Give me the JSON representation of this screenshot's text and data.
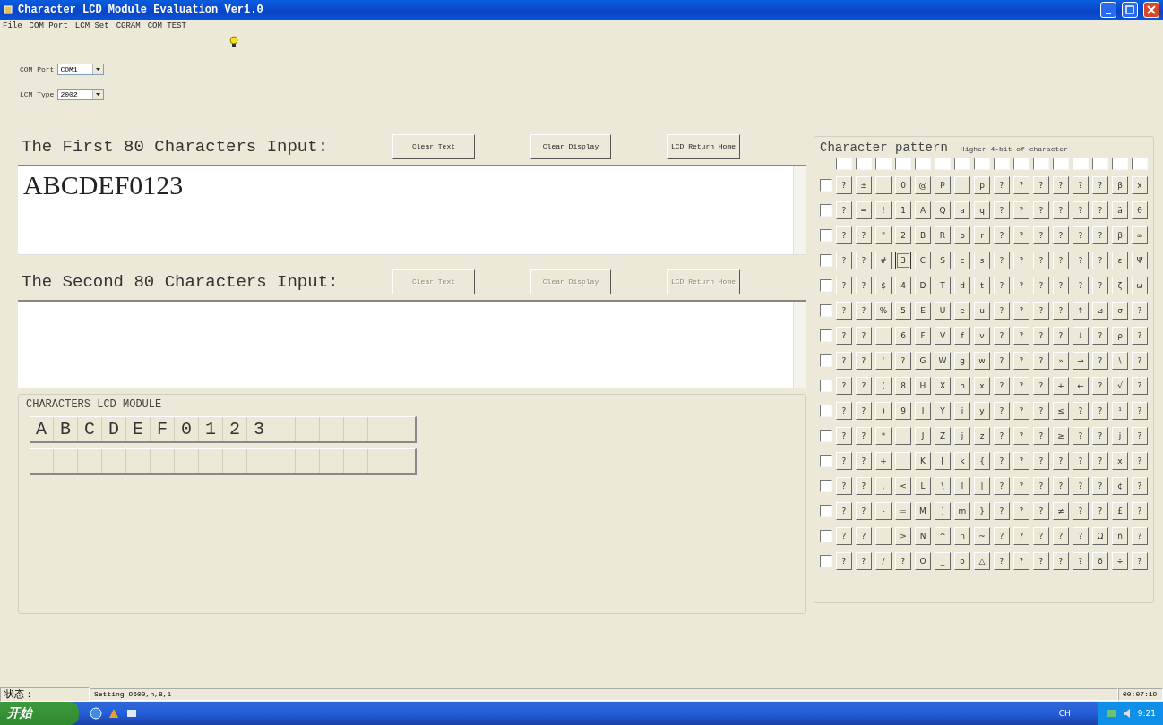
{
  "window": {
    "title": "Character LCD Module Evaluation Ver1.0"
  },
  "menu": [
    "File",
    "COM Port",
    "LCM Set",
    "CGRAM",
    "COM TEST"
  ],
  "settings": [
    {
      "label": "COM Port",
      "value": "COM1"
    },
    {
      "label": "LCM Type",
      "value": "2002"
    }
  ],
  "inputs": [
    {
      "label": "The First 80 Characters Input:",
      "value": "ABCDEF0123",
      "buttons": [
        {
          "label": "Clear Text",
          "disabled": false
        },
        {
          "label": "Clear Display",
          "disabled": false
        },
        {
          "label": "LCD Return Home",
          "disabled": false
        }
      ]
    },
    {
      "label": "The Second 80 Characters Input:",
      "buttons": [
        {
          "label": "Clear Text",
          "disabled": true
        },
        {
          "label": "Clear Display",
          "disabled": true
        },
        {
          "label": "LCD Return Home",
          "disabled": true
        }
      ]
    }
  ],
  "lcd": {
    "title": "CHARACTERS LCD MODULE",
    "lines": [
      "ABCDEF0123"
    ]
  },
  "pattern": {
    "title": "Character pattern",
    "subtitle": "Higher 4-bit of character",
    "column_checks": [
      false,
      false,
      false,
      false,
      false,
      false,
      false,
      false,
      false,
      false,
      false,
      false,
      false,
      false,
      false,
      false
    ],
    "rows": [
      {
        "checked": false,
        "cells": [
          {
            "char": "?",
            "selected": false
          },
          {
            "char": "±",
            "selected": false
          },
          {
            "selected": false
          },
          {
            "char": "0",
            "selected": false
          },
          {
            "char": "@",
            "selected": false
          },
          {
            "char": "P",
            "selected": false
          },
          {
            "selected": false
          },
          {
            "char": "p",
            "selected": false
          },
          {
            "char": "?",
            "selected": false
          },
          {
            "char": "?",
            "selected": false
          },
          {
            "char": "?",
            "selected": false
          },
          {
            "char": "?",
            "selected": false
          },
          {
            "char": "?",
            "selected": false
          },
          {
            "char": "?",
            "selected": false
          },
          {
            "char": "β",
            "selected": false
          },
          {
            "char": "x",
            "selected": false
          }
        ]
      },
      {
        "checked": false,
        "cells": [
          {
            "char": "?",
            "selected": false
          },
          {
            "char": "═",
            "selected": false
          },
          {
            "char": "!",
            "selected": false
          },
          {
            "char": "1",
            "selected": false
          },
          {
            "char": "A",
            "selected": false
          },
          {
            "char": "Q",
            "selected": false
          },
          {
            "char": "a",
            "selected": false
          },
          {
            "char": "q",
            "selected": false
          },
          {
            "char": "?",
            "selected": false
          },
          {
            "char": "?",
            "selected": false
          },
          {
            "char": "?",
            "selected": false
          },
          {
            "char": "?",
            "selected": false
          },
          {
            "char": "?",
            "selected": false
          },
          {
            "char": "?",
            "selected": false
          },
          {
            "char": "ä",
            "selected": false
          },
          {
            "char": "θ",
            "selected": false
          }
        ]
      },
      {
        "checked": false,
        "cells": [
          {
            "char": "?",
            "selected": false
          },
          {
            "char": "?",
            "selected": false
          },
          {
            "char": "\"",
            "selected": false
          },
          {
            "char": "2",
            "selected": false
          },
          {
            "char": "B",
            "selected": false
          },
          {
            "char": "R",
            "selected": false
          },
          {
            "char": "b",
            "selected": false
          },
          {
            "char": "r",
            "selected": false
          },
          {
            "char": "?",
            "selected": false
          },
          {
            "char": "?",
            "selected": false
          },
          {
            "char": "?",
            "selected": false
          },
          {
            "char": "?",
            "selected": false
          },
          {
            "char": "?",
            "selected": false
          },
          {
            "char": "?",
            "selected": false
          },
          {
            "char": "β",
            "selected": false
          },
          {
            "char": "∞",
            "selected": false
          }
        ]
      },
      {
        "checked": false,
        "cells": [
          {
            "char": "?",
            "selected": false
          },
          {
            "char": "?",
            "selected": false
          },
          {
            "char": "#",
            "selected": false
          },
          {
            "char": "3",
            "selected": true
          },
          {
            "char": "C",
            "selected": false
          },
          {
            "char": "S",
            "selected": false
          },
          {
            "char": "c",
            "selected": false
          },
          {
            "char": "s",
            "selected": false
          },
          {
            "char": "?",
            "selected": false
          },
          {
            "char": "?",
            "selected": false
          },
          {
            "char": "?",
            "selected": false
          },
          {
            "char": "?",
            "selected": false
          },
          {
            "char": "?",
            "selected": false
          },
          {
            "char": "?",
            "selected": false
          },
          {
            "char": "ε",
            "selected": false
          },
          {
            "char": "Ψ",
            "selected": false
          }
        ]
      },
      {
        "checked": false,
        "cells": [
          {
            "char": "?",
            "selected": false
          },
          {
            "char": "?",
            "selected": false
          },
          {
            "char": "$",
            "selected": false
          },
          {
            "char": "4",
            "selected": false
          },
          {
            "char": "D",
            "selected": false
          },
          {
            "char": "T",
            "selected": false
          },
          {
            "char": "d",
            "selected": false
          },
          {
            "char": "t",
            "selected": false
          },
          {
            "char": "?",
            "selected": false
          },
          {
            "char": "?",
            "selected": false
          },
          {
            "char": "?",
            "selected": false
          },
          {
            "char": "?",
            "selected": false
          },
          {
            "char": "?",
            "selected": false
          },
          {
            "char": "?",
            "selected": false
          },
          {
            "char": "ζ",
            "selected": false
          },
          {
            "char": "ω",
            "selected": false
          }
        ]
      },
      {
        "checked": false,
        "cells": [
          {
            "char": "?",
            "selected": false
          },
          {
            "char": "?",
            "selected": false
          },
          {
            "char": "%",
            "selected": false
          },
          {
            "char": "5",
            "selected": false
          },
          {
            "char": "E",
            "selected": false
          },
          {
            "char": "U",
            "selected": false
          },
          {
            "char": "e",
            "selected": false
          },
          {
            "char": "u",
            "selected": false
          },
          {
            "char": "?",
            "selected": false
          },
          {
            "char": "?",
            "selected": false
          },
          {
            "char": "?",
            "selected": false
          },
          {
            "char": "?",
            "selected": false
          },
          {
            "char": "↑",
            "selected": false
          },
          {
            "char": "⊿",
            "selected": false
          },
          {
            "char": "σ",
            "selected": false
          },
          {
            "char": "?",
            "selected": false
          }
        ]
      },
      {
        "checked": false,
        "cells": [
          {
            "char": "?",
            "selected": false
          },
          {
            "char": "?",
            "selected": false
          },
          {
            "selected": false
          },
          {
            "char": "6",
            "selected": false
          },
          {
            "char": "F",
            "selected": false
          },
          {
            "char": "V",
            "selected": false
          },
          {
            "char": "f",
            "selected": false
          },
          {
            "char": "v",
            "selected": false
          },
          {
            "char": "?",
            "selected": false
          },
          {
            "char": "?",
            "selected": false
          },
          {
            "char": "?",
            "selected": false
          },
          {
            "char": "?",
            "selected": false
          },
          {
            "char": "↓",
            "selected": false
          },
          {
            "char": "?",
            "selected": false
          },
          {
            "char": "ρ",
            "selected": false
          },
          {
            "char": "?",
            "selected": false
          }
        ]
      },
      {
        "checked": false,
        "cells": [
          {
            "char": "?",
            "selected": false
          },
          {
            "char": "?",
            "selected": false
          },
          {
            "char": "'",
            "selected": false
          },
          {
            "char": "?",
            "selected": false
          },
          {
            "char": "G",
            "selected": false
          },
          {
            "char": "W",
            "selected": false
          },
          {
            "char": "g",
            "selected": false
          },
          {
            "char": "w",
            "selected": false
          },
          {
            "char": "?",
            "selected": false
          },
          {
            "char": "?",
            "selected": false
          },
          {
            "char": "?",
            "selected": false
          },
          {
            "char": "»",
            "selected": false
          },
          {
            "char": "→",
            "selected": false
          },
          {
            "char": "?",
            "selected": false
          },
          {
            "char": "\\",
            "selected": false
          },
          {
            "char": "?",
            "selected": false
          }
        ]
      },
      {
        "checked": false,
        "cells": [
          {
            "char": "?",
            "selected": false
          },
          {
            "char": "?",
            "selected": false
          },
          {
            "char": "(",
            "selected": false
          },
          {
            "char": "8",
            "selected": false
          },
          {
            "char": "H",
            "selected": false
          },
          {
            "char": "X",
            "selected": false
          },
          {
            "char": "h",
            "selected": false
          },
          {
            "char": "x",
            "selected": false
          },
          {
            "char": "?",
            "selected": false
          },
          {
            "char": "?",
            "selected": false
          },
          {
            "char": "?",
            "selected": false
          },
          {
            "char": "+",
            "selected": false
          },
          {
            "char": "←",
            "selected": false
          },
          {
            "char": "?",
            "selected": false
          },
          {
            "char": "√",
            "selected": false
          },
          {
            "char": "?",
            "selected": false
          }
        ]
      },
      {
        "checked": false,
        "cells": [
          {
            "char": "?",
            "selected": false
          },
          {
            "char": "?",
            "selected": false
          },
          {
            "char": ")",
            "selected": false
          },
          {
            "char": "9",
            "selected": false
          },
          {
            "char": "I",
            "selected": false
          },
          {
            "char": "Y",
            "selected": false
          },
          {
            "char": "i",
            "selected": false
          },
          {
            "char": "y",
            "selected": false
          },
          {
            "char": "?",
            "selected": false
          },
          {
            "char": "?",
            "selected": false
          },
          {
            "char": "?",
            "selected": false
          },
          {
            "char": "≤",
            "selected": false
          },
          {
            "char": "?",
            "selected": false
          },
          {
            "char": "?",
            "selected": false
          },
          {
            "char": "¹",
            "selected": false
          },
          {
            "char": "?",
            "selected": false
          }
        ]
      },
      {
        "checked": false,
        "cells": [
          {
            "char": "?",
            "selected": false
          },
          {
            "char": "?",
            "selected": false
          },
          {
            "char": "*",
            "selected": false
          },
          {
            "selected": false
          },
          {
            "char": "J",
            "selected": false
          },
          {
            "char": "Z",
            "selected": false
          },
          {
            "char": "j",
            "selected": false
          },
          {
            "char": "z",
            "selected": false
          },
          {
            "char": "?",
            "selected": false
          },
          {
            "char": "?",
            "selected": false
          },
          {
            "char": "?",
            "selected": false
          },
          {
            "char": "≥",
            "selected": false
          },
          {
            "char": "?",
            "selected": false
          },
          {
            "char": "?",
            "selected": false
          },
          {
            "char": "j",
            "selected": false
          },
          {
            "char": "?",
            "selected": false
          }
        ]
      },
      {
        "checked": false,
        "cells": [
          {
            "char": "?",
            "selected": false
          },
          {
            "char": "?",
            "selected": false
          },
          {
            "char": "+",
            "selected": false
          },
          {
            "selected": false
          },
          {
            "char": "K",
            "selected": false
          },
          {
            "char": "[",
            "selected": false
          },
          {
            "char": "k",
            "selected": false
          },
          {
            "char": "{",
            "selected": false
          },
          {
            "char": "?",
            "selected": false
          },
          {
            "char": "?",
            "selected": false
          },
          {
            "char": "?",
            "selected": false
          },
          {
            "char": "?",
            "selected": false
          },
          {
            "char": "?",
            "selected": false
          },
          {
            "char": "?",
            "selected": false
          },
          {
            "char": "x",
            "selected": false
          },
          {
            "char": "?",
            "selected": false
          }
        ]
      },
      {
        "checked": false,
        "cells": [
          {
            "char": "?",
            "selected": false
          },
          {
            "char": "?",
            "selected": false
          },
          {
            "char": ",",
            "selected": false
          },
          {
            "char": "<",
            "selected": false
          },
          {
            "char": "L",
            "selected": false
          },
          {
            "char": "\\",
            "selected": false
          },
          {
            "char": "l",
            "selected": false
          },
          {
            "char": "|",
            "selected": false
          },
          {
            "char": "?",
            "selected": false
          },
          {
            "char": "?",
            "selected": false
          },
          {
            "char": "?",
            "selected": false
          },
          {
            "char": "?",
            "selected": false
          },
          {
            "char": "?",
            "selected": false
          },
          {
            "char": "?",
            "selected": false
          },
          {
            "char": "¢",
            "selected": false
          },
          {
            "char": "?",
            "selected": false
          }
        ]
      },
      {
        "checked": false,
        "cells": [
          {
            "char": "?",
            "selected": false
          },
          {
            "char": "?",
            "selected": false
          },
          {
            "char": "-",
            "selected": false
          },
          {
            "char": "=",
            "selected": false
          },
          {
            "char": "M",
            "selected": false
          },
          {
            "char": "]",
            "selected": false
          },
          {
            "char": "m",
            "selected": false
          },
          {
            "char": "}",
            "selected": false
          },
          {
            "char": "?",
            "selected": false
          },
          {
            "char": "?",
            "selected": false
          },
          {
            "char": "?",
            "selected": false
          },
          {
            "char": "≠",
            "selected": false
          },
          {
            "char": "?",
            "selected": false
          },
          {
            "char": "?",
            "selected": false
          },
          {
            "char": "£",
            "selected": false
          },
          {
            "char": "?",
            "selected": false
          }
        ]
      },
      {
        "checked": false,
        "cells": [
          {
            "char": "?",
            "selected": false
          },
          {
            "char": "?",
            "selected": false
          },
          {
            "selected": false
          },
          {
            "char": ">",
            "selected": false
          },
          {
            "char": "N",
            "selected": false
          },
          {
            "char": "^",
            "selected": false
          },
          {
            "char": "n",
            "selected": false
          },
          {
            "char": "~",
            "selected": false
          },
          {
            "char": "?",
            "selected": false
          },
          {
            "char": "?",
            "selected": false
          },
          {
            "char": "?",
            "selected": false
          },
          {
            "char": "?",
            "selected": false
          },
          {
            "char": "?",
            "selected": false
          },
          {
            "char": "Ω",
            "selected": false
          },
          {
            "char": "ñ",
            "selected": false
          },
          {
            "char": "?",
            "selected": false
          }
        ]
      },
      {
        "checked": false,
        "cells": [
          {
            "char": "?",
            "selected": false
          },
          {
            "char": "?",
            "selected": false
          },
          {
            "char": "/",
            "selected": false
          },
          {
            "char": "?",
            "selected": false
          },
          {
            "char": "O",
            "selected": false
          },
          {
            "char": "_",
            "selected": false
          },
          {
            "char": "o",
            "selected": false
          },
          {
            "char": "△",
            "selected": false
          },
          {
            "char": "?",
            "selected": false
          },
          {
            "char": "?",
            "selected": false
          },
          {
            "char": "?",
            "selected": false
          },
          {
            "char": "?",
            "selected": false
          },
          {
            "char": "?",
            "selected": false
          },
          {
            "char": "ö",
            "selected": false
          },
          {
            "char": "÷",
            "selected": false
          },
          {
            "char": "?",
            "selected": false
          }
        ]
      }
    ]
  },
  "status_bar": {
    "state": "状态：",
    "setting": "Setting  9600,n,8,1",
    "time": "00:07:19"
  },
  "taskbar": {
    "start": "开始",
    "language": "CH",
    "clock": "9:21"
  }
}
